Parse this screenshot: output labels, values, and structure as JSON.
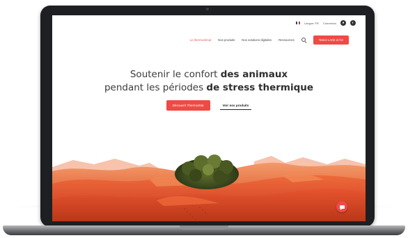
{
  "utility": {
    "language_label": "Langue: FR",
    "account_label": "Connexion",
    "flag_colors": [
      "#1f3e8f",
      "#ffffff",
      "#d8322e"
    ]
  },
  "nav": {
    "items": [
      {
        "label": "Le thermoclimat"
      },
      {
        "label": "Nos produits"
      },
      {
        "label": "Nos solutions digitales"
      },
      {
        "label": "Ressources"
      }
    ],
    "cta_label": "Testez LAKE et l'or"
  },
  "hero": {
    "title_line1_light": "Soutenir le confort",
    "title_line1_bold": "des animaux",
    "title_line2_light": "pendant les périodes",
    "title_line2_bold": "de stress thermique",
    "primary_button": "Découvrir ThermoStat",
    "secondary_button": "Voir nos produits"
  },
  "colors": {
    "accent": "#ef4a45",
    "sand_light": "#f07a45",
    "sand_dark": "#c8401e",
    "sky": "#ffffff",
    "bezel": "#1e1f22"
  },
  "icons": {
    "search": "search-icon",
    "chat": "chat-icon",
    "language": "flag-icon"
  }
}
